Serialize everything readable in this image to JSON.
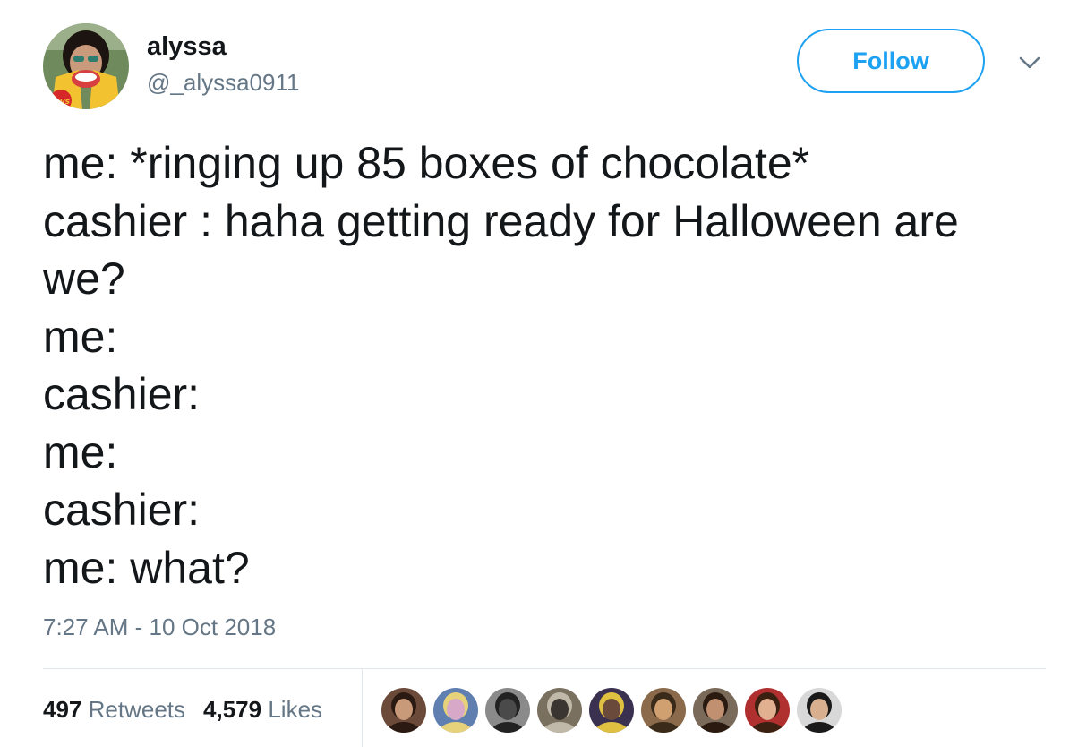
{
  "user": {
    "display_name": "alyssa",
    "handle": "@_alyssa0911",
    "avatar_logo_text": "lays"
  },
  "header": {
    "follow_label": "Follow",
    "caret_icon": "chevron-down-icon"
  },
  "tweet": {
    "text": "me: *ringing up 85 boxes of chocolate*\ncashier : haha getting ready for Halloween are we?\nme:\ncashier:\nme:\ncashier:\nme: what?",
    "timestamp": "7:27 AM - 10 Oct 2018"
  },
  "stats": {
    "retweets_count": "497",
    "retweets_label": "Retweets",
    "likes_count": "4,579",
    "likes_label": "Likes"
  },
  "likers": [
    {
      "name": "liker-avatar-1",
      "bg": "#6b4a3a",
      "face": "#c89a7a",
      "hair": "#2b1a12"
    },
    {
      "name": "liker-avatar-2",
      "bg": "#5f7fb0",
      "face": "#d7a8c8",
      "hair": "#e6d27a"
    },
    {
      "name": "liker-avatar-3",
      "bg": "#8a8a8a",
      "face": "#4a4a4a",
      "hair": "#222222"
    },
    {
      "name": "liker-avatar-4",
      "bg": "#7a7060",
      "face": "#3a3530",
      "hair": "#c0b8a8"
    },
    {
      "name": "liker-avatar-5",
      "bg": "#3a3050",
      "face": "#6a4a3a",
      "hair": "#e0c040"
    },
    {
      "name": "liker-avatar-6",
      "bg": "#8a6a4a",
      "face": "#d0a070",
      "hair": "#3a2a1a"
    },
    {
      "name": "liker-avatar-7",
      "bg": "#7a6a5a",
      "face": "#c09070",
      "hair": "#2a1a10"
    },
    {
      "name": "liker-avatar-8",
      "bg": "#b03030",
      "face": "#e0b090",
      "hair": "#3a2010"
    },
    {
      "name": "liker-avatar-9",
      "bg": "#d8d8d8",
      "face": "#d8b090",
      "hair": "#1a1a1a"
    }
  ]
}
